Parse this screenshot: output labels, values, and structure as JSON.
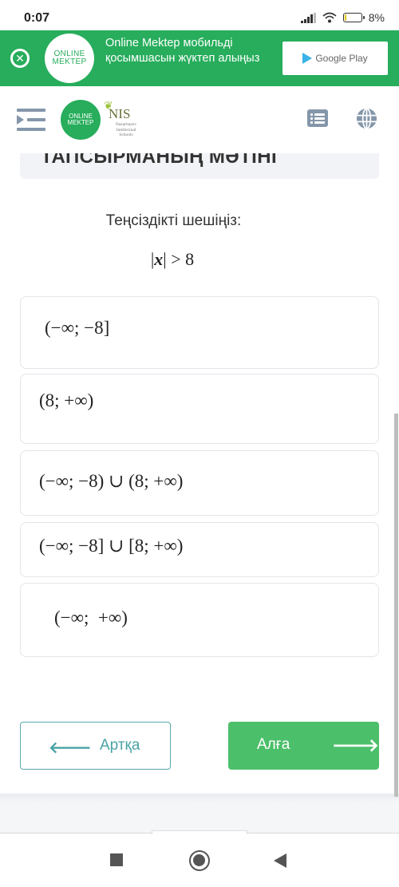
{
  "status_bar": {
    "time": "0:07",
    "battery_percent_label": "8%",
    "battery_level": 0.08,
    "icons": [
      "signal-icon",
      "wifi-icon",
      "battery-icon"
    ]
  },
  "app_banner": {
    "logo_line1": "ONLINE",
    "logo_line2": "MEKTEP",
    "message": "Online Mektep мобильді қосымшасын жүктеп алыңыз",
    "store_button_label": "Google Play",
    "close_icon": "close-circle-icon"
  },
  "header": {
    "menu_icon": "menu-collapse-icon",
    "online_mektep_logo": {
      "line1": "ONLINE",
      "line2": "MEKTEP"
    },
    "nis_logo": {
      "title": "NIS",
      "subtitle_lines": [
        "Nazarbayev",
        "Intellectual",
        "Schools"
      ]
    },
    "right_icons": [
      "list-icon",
      "globe-icon"
    ]
  },
  "task": {
    "heading": "ТАПСЫРМАНЫҢ МӘТІНІ",
    "question": "Теңсіздікті шешіңіз:",
    "formula": {
      "abs_open": "|",
      "variable": "x",
      "abs_close": "|",
      "relation": " > 8"
    }
  },
  "options": [
    {
      "label": "(−∞; −8]"
    },
    {
      "label": "(8; +∞)"
    },
    {
      "label": "(−∞; −8) ∪ (8; +∞)"
    },
    {
      "label": "(−∞; −8] ∪ [8; +∞)"
    },
    {
      "label": "(−∞;  +∞)"
    }
  ],
  "navigation": {
    "back_label": "Артқа",
    "back_icon": "arrow-left-icon",
    "next_label": "Алға",
    "next_icon": "arrow-right-icon"
  },
  "colors": {
    "brand_green": "#27ad5c",
    "next_button": "#4cbf6a",
    "back_button_accent": "#4aa3a6",
    "header_icon": "#8496aa"
  }
}
